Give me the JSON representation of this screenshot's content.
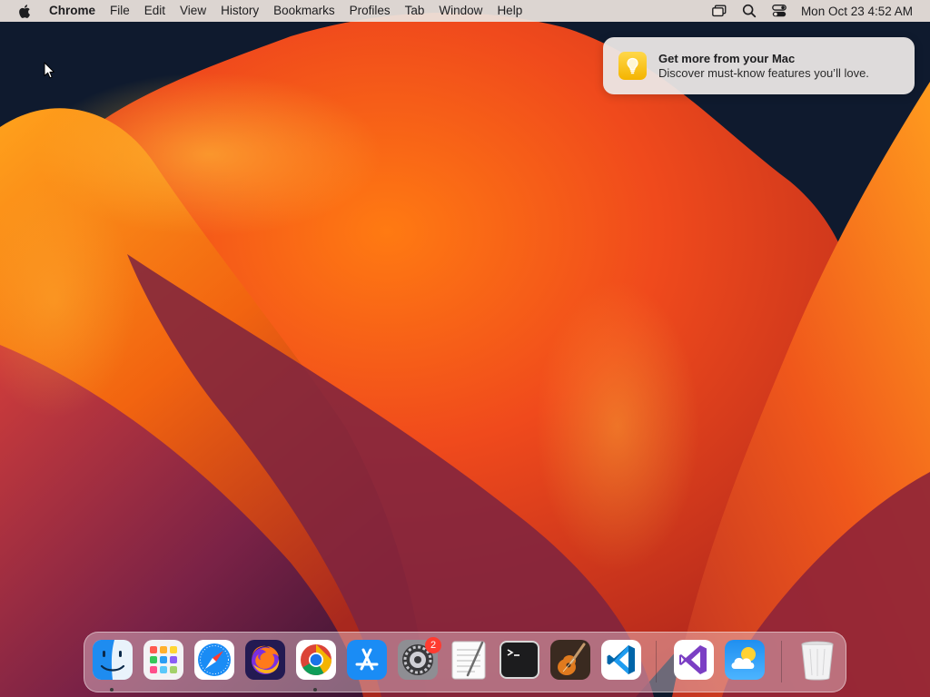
{
  "menubar": {
    "app_name": "Chrome",
    "menus": [
      "File",
      "Edit",
      "View",
      "History",
      "Bookmarks",
      "Profiles",
      "Tab",
      "Window",
      "Help"
    ],
    "status_icons": [
      "screen-mirroring-icon",
      "spotlight-search-icon",
      "control-center-icon"
    ],
    "clock": "Mon Oct 23  4:52 AM"
  },
  "notification": {
    "icon": "lightbulb-icon",
    "title": "Get more from your Mac",
    "body": "Discover must-know features you’ll love."
  },
  "dock": {
    "apps": [
      {
        "name": "Finder",
        "icon": "finder-icon",
        "running": true
      },
      {
        "name": "Launchpad",
        "icon": "launchpad-icon",
        "running": false
      },
      {
        "name": "Safari",
        "icon": "safari-icon",
        "running": false
      },
      {
        "name": "Firefox",
        "icon": "firefox-icon",
        "running": false
      },
      {
        "name": "Google Chrome",
        "icon": "chrome-icon",
        "running": true
      },
      {
        "name": "App Store",
        "icon": "app-store-icon",
        "running": false
      },
      {
        "name": "System Settings",
        "icon": "system-settings-icon",
        "running": false,
        "badge": "2"
      },
      {
        "name": "TextEdit",
        "icon": "textedit-icon",
        "running": false
      },
      {
        "name": "Terminal",
        "icon": "terminal-icon",
        "running": false
      },
      {
        "name": "GarageBand",
        "icon": "garageband-icon",
        "running": false
      },
      {
        "name": "Visual Studio Code",
        "icon": "vscode-icon",
        "running": false
      },
      {
        "name": "Visual Studio",
        "icon": "visual-studio-icon",
        "running": false
      },
      {
        "name": "Weather",
        "icon": "weather-icon",
        "running": false
      },
      {
        "name": "Trash",
        "icon": "trash-icon",
        "running": false
      }
    ]
  },
  "colors": {
    "menubar_bg": "#ece4de",
    "badge": "#ff3b30",
    "wallpaper_primary": "#f05a1a",
    "wallpaper_dark": "#0f1a2e"
  }
}
